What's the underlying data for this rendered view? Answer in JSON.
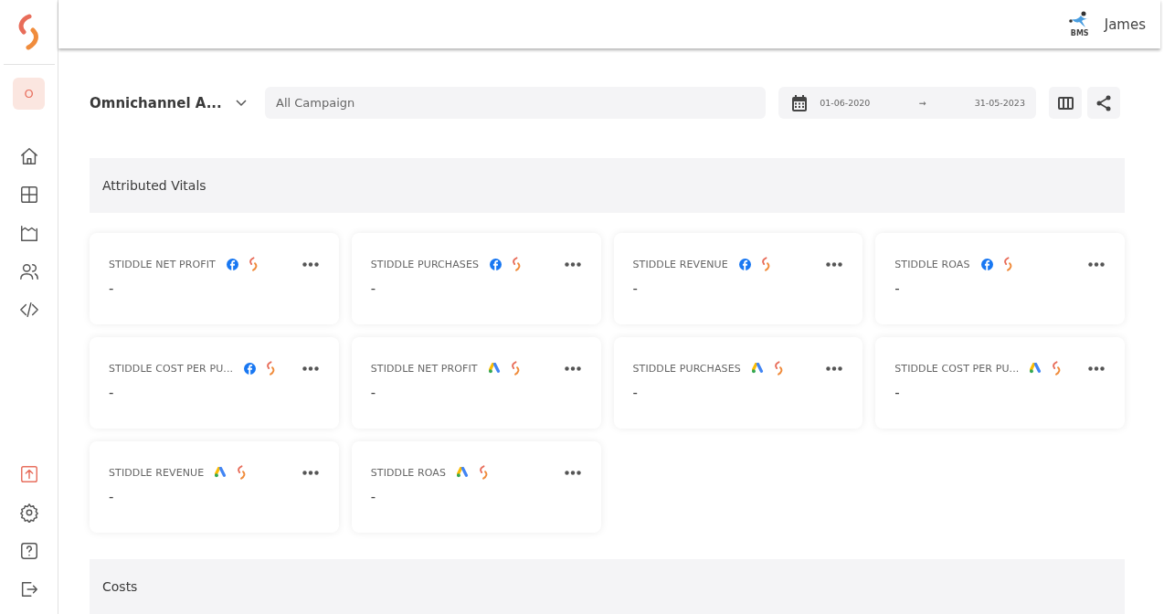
{
  "sidebar": {
    "workspace_initial": "O"
  },
  "header": {
    "brand_label": "BMS",
    "user_name": "James"
  },
  "toolbar": {
    "report_name": "Omnichannel A...",
    "campaign_select": {
      "placeholder": "All Campaign"
    },
    "date_range": {
      "start": "01-06-2020",
      "arrow": "→",
      "end": "31-05-2023"
    }
  },
  "sections": [
    {
      "title": "Attributed Vitals",
      "cards": [
        {
          "title": "STIDDLE NET PROFIT",
          "kind": "facebook",
          "value": "-"
        },
        {
          "title": "STIDDLE PURCHASES",
          "kind": "facebook",
          "value": "-"
        },
        {
          "title": "STIDDLE REVENUE",
          "kind": "facebook",
          "value": "-"
        },
        {
          "title": "STIDDLE ROAS",
          "kind": "facebook",
          "value": "-"
        },
        {
          "title": "STIDDLE COST PER PU...",
          "kind": "facebook",
          "value": "-"
        },
        {
          "title": "STIDDLE NET PROFIT",
          "kind": "google",
          "value": "-"
        },
        {
          "title": "STIDDLE PURCHASES",
          "kind": "google",
          "value": "-"
        },
        {
          "title": "STIDDLE COST PER PU...",
          "kind": "google",
          "value": "-"
        },
        {
          "title": "STIDDLE REVENUE",
          "kind": "google",
          "value": "-"
        },
        {
          "title": "STIDDLE ROAS",
          "kind": "google",
          "value": "-"
        }
      ]
    },
    {
      "title": "Costs"
    }
  ]
}
